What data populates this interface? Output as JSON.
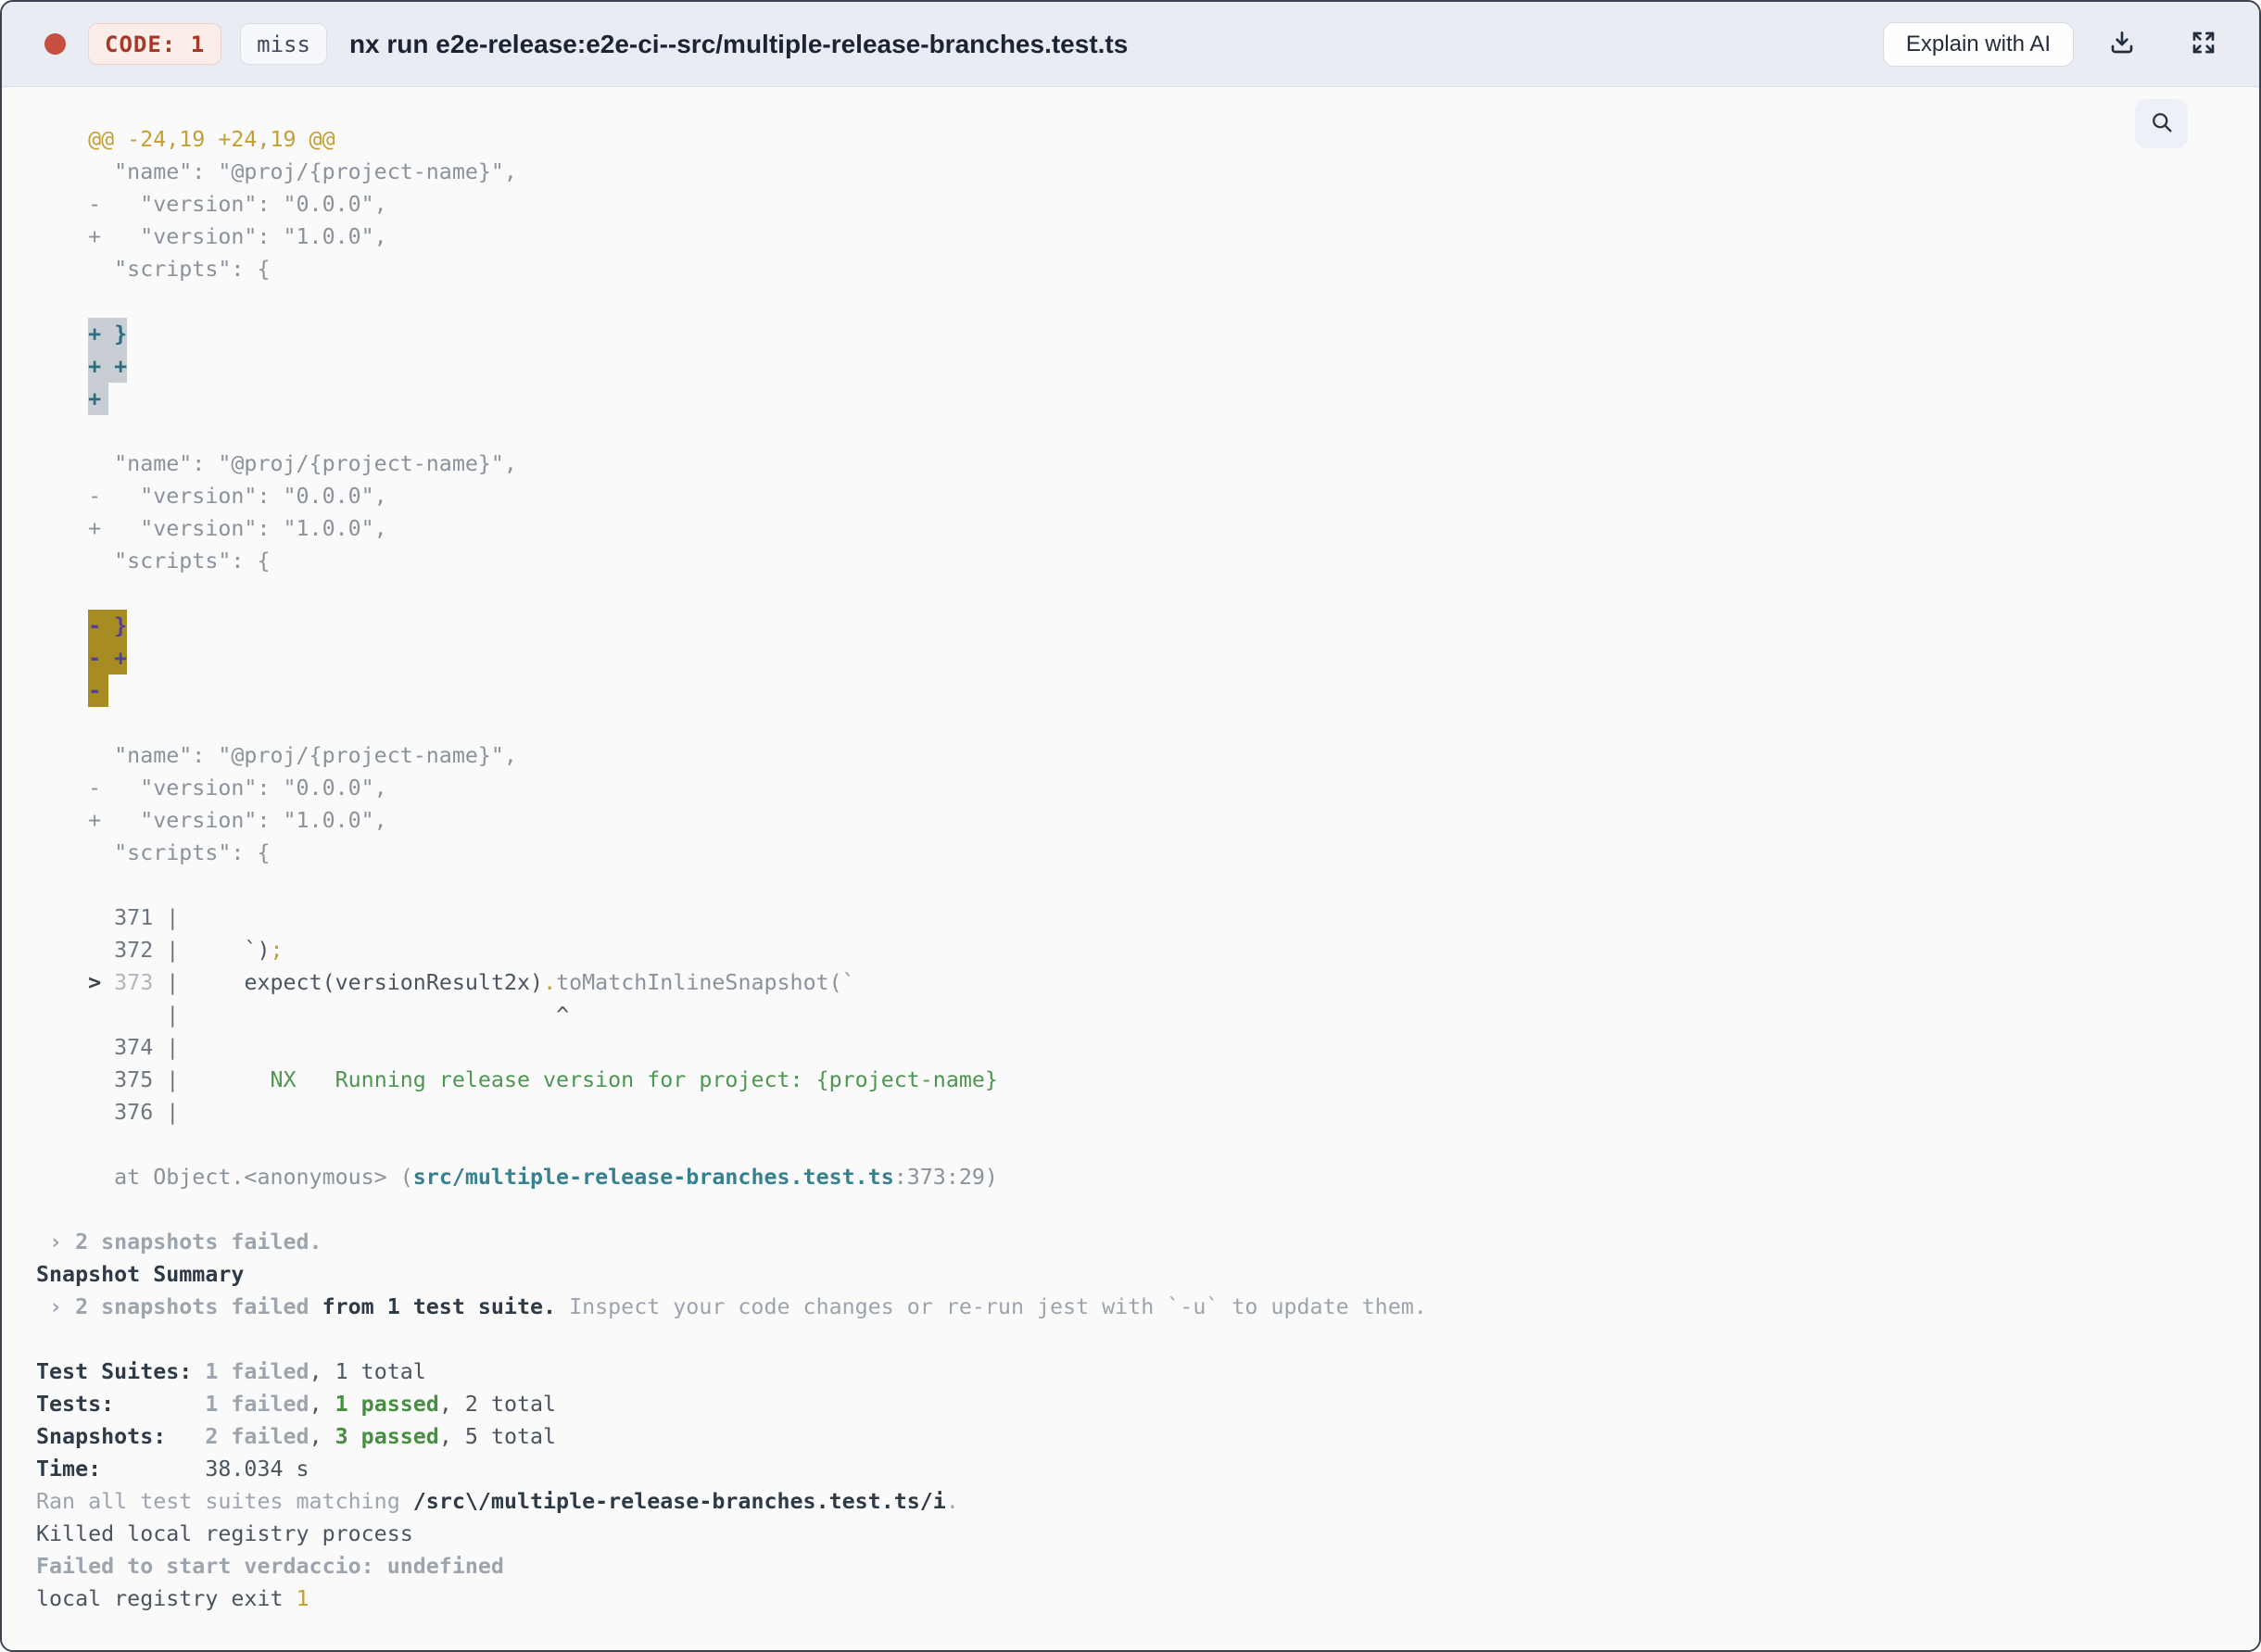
{
  "header": {
    "exit_code_badge": "CODE: 1",
    "cache_badge": "miss",
    "title": "nx run e2e-release:e2e-ci--src/multiple-release-branches.test.ts",
    "explain_button": "Explain with AI",
    "status_dot_color": "#C5503F",
    "icons": {
      "download": "download-tray-arrow",
      "expand": "fullscreen-four-arrows",
      "search": "magnifier"
    }
  },
  "colors": {
    "header_bg": "#E9EDF3",
    "content_bg": "#FAFAFB",
    "diff_hunk_gold": "#C2A033",
    "context_gray": "#8A929C",
    "added_highlight_bg": "#C9CED4",
    "added_highlight_fg": "#2C6E80",
    "removed_highlight_bg": "#A78C22",
    "removed_highlight_fg": "#4E3FA2",
    "pass_green": "#478E41",
    "link_teal": "#35818F",
    "fail_gray": "#9CA4AD",
    "code_badge_red": "#A63A2A"
  },
  "terminal": {
    "lines": [
      {
        "segments": [
          {
            "t": "    @@ -24,19 +24,19 @@",
            "s": "gold"
          }
        ]
      },
      {
        "segments": [
          {
            "t": "      \"name\": \"@proj/{project-name}\",",
            "s": "ctx"
          }
        ]
      },
      {
        "segments": [
          {
            "t": "    -   \"version\": \"0.0.0\",",
            "s": "ctx"
          }
        ]
      },
      {
        "segments": [
          {
            "t": "    +   \"version\": \"1.0.0\",",
            "s": "ctx"
          }
        ]
      },
      {
        "segments": [
          {
            "t": "      \"scripts\": {",
            "s": "ctx"
          }
        ]
      },
      {
        "segments": []
      },
      {
        "segments": [
          {
            "t": "    ",
            "s": "ctx"
          },
          {
            "t": "+ }",
            "s": "add"
          }
        ]
      },
      {
        "segments": [
          {
            "t": "    ",
            "s": "ctx"
          },
          {
            "t": "+ +",
            "s": "add"
          }
        ]
      },
      {
        "segments": [
          {
            "t": "    ",
            "s": "ctx"
          },
          {
            "t": "+",
            "s": "add",
            "pad": true
          }
        ]
      },
      {
        "segments": []
      },
      {
        "segments": [
          {
            "t": "      \"name\": \"@proj/{project-name}\",",
            "s": "ctx"
          }
        ]
      },
      {
        "segments": [
          {
            "t": "    -   \"version\": \"0.0.0\",",
            "s": "ctx"
          }
        ]
      },
      {
        "segments": [
          {
            "t": "    +   \"version\": \"1.0.0\",",
            "s": "ctx"
          }
        ]
      },
      {
        "segments": [
          {
            "t": "      \"scripts\": {",
            "s": "ctx"
          }
        ]
      },
      {
        "segments": []
      },
      {
        "segments": [
          {
            "t": "    ",
            "s": "ctx"
          },
          {
            "t": "- }",
            "s": "del"
          }
        ]
      },
      {
        "segments": [
          {
            "t": "    ",
            "s": "ctx"
          },
          {
            "t": "- +",
            "s": "del"
          }
        ]
      },
      {
        "segments": [
          {
            "t": "    ",
            "s": "ctx"
          },
          {
            "t": "-",
            "s": "del",
            "pad": true
          }
        ]
      },
      {
        "segments": []
      },
      {
        "segments": [
          {
            "t": "      \"name\": \"@proj/{project-name}\",",
            "s": "ctx"
          }
        ]
      },
      {
        "segments": [
          {
            "t": "    -   \"version\": \"0.0.0\",",
            "s": "ctx"
          }
        ]
      },
      {
        "segments": [
          {
            "t": "    +   \"version\": \"1.0.0\",",
            "s": "ctx"
          }
        ]
      },
      {
        "segments": [
          {
            "t": "      \"scripts\": {",
            "s": "ctx"
          }
        ]
      },
      {
        "segments": []
      },
      {
        "segments": [
          {
            "t": "      371 |",
            "s": "ln"
          }
        ]
      },
      {
        "segments": [
          {
            "t": "      372 |",
            "s": "ln"
          },
          {
            "t": "     ",
            "s": "ctx"
          },
          {
            "t": "`)",
            "s": "dark"
          },
          {
            "t": ";",
            "s": "gold"
          }
        ]
      },
      {
        "segments": [
          {
            "t": "    ",
            "s": "ctx"
          },
          {
            "t": ">",
            "s": "arrow"
          },
          {
            "t": " ",
            "s": "ctx"
          },
          {
            "t": "373",
            "s": "lnd"
          },
          {
            "t": " |",
            "s": "ln"
          },
          {
            "t": "     ",
            "s": "ctx"
          },
          {
            "t": "expect(versionResult2x)",
            "s": "dark"
          },
          {
            "t": ".",
            "s": "gold"
          },
          {
            "t": "toMatchInlineSnapshot(`",
            "s": "ctx"
          }
        ]
      },
      {
        "segments": [
          {
            "t": "          |",
            "s": "ln"
          },
          {
            "t": "                             ",
            "s": "ctx"
          },
          {
            "t": "^",
            "s": "caret"
          }
        ]
      },
      {
        "segments": [
          {
            "t": "      374 |",
            "s": "ln"
          }
        ]
      },
      {
        "segments": [
          {
            "t": "      375 |",
            "s": "ln"
          },
          {
            "t": "       ",
            "s": "ctx"
          },
          {
            "t": "NX   Running release version for project: {project-name}",
            "s": "green"
          }
        ]
      },
      {
        "segments": [
          {
            "t": "      376 |",
            "s": "ln"
          }
        ]
      },
      {
        "segments": []
      },
      {
        "segments": [
          {
            "t": "      at Object.<anonymous> (",
            "s": "ctx"
          },
          {
            "t": "src/multiple-release-branches.test.ts",
            "s": "teal"
          },
          {
            "t": ":373:29)",
            "s": "ctx"
          }
        ]
      },
      {
        "segments": []
      },
      {
        "segments": [
          {
            "t": " › 2 snapshots failed.",
            "s": "grayb"
          }
        ]
      },
      {
        "segments": [
          {
            "t": "Snapshot Summary",
            "s": "darkb"
          }
        ]
      },
      {
        "segments": [
          {
            "t": " › 2 snapshots failed",
            "s": "grayb"
          },
          {
            "t": " from 1 test suite.",
            "s": "darkb"
          },
          {
            "t": " Inspect your code changes or re-run jest with `-u` to update them.",
            "s": "gray"
          }
        ]
      },
      {
        "segments": []
      },
      {
        "segments": [
          {
            "t": "Test Suites:",
            "s": "darkb"
          },
          {
            "t": " ",
            "s": "dark"
          },
          {
            "t": "1 failed",
            "s": "grayb"
          },
          {
            "t": ", 1 total",
            "s": "dark"
          }
        ]
      },
      {
        "segments": [
          {
            "t": "Tests:",
            "s": "darkb"
          },
          {
            "t": "       ",
            "s": "dark"
          },
          {
            "t": "1 failed",
            "s": "grayb"
          },
          {
            "t": ", ",
            "s": "dark"
          },
          {
            "t": "1 passed",
            "s": "greenb"
          },
          {
            "t": ", 2 total",
            "s": "dark"
          }
        ]
      },
      {
        "segments": [
          {
            "t": "Snapshots:",
            "s": "darkb"
          },
          {
            "t": "   ",
            "s": "dark"
          },
          {
            "t": "2 failed",
            "s": "grayb"
          },
          {
            "t": ", ",
            "s": "dark"
          },
          {
            "t": "3 passed",
            "s": "greenb"
          },
          {
            "t": ", 5 total",
            "s": "dark"
          }
        ]
      },
      {
        "segments": [
          {
            "t": "Time:",
            "s": "darkb"
          },
          {
            "t": "        ",
            "s": "dark"
          },
          {
            "t": "38.034 s",
            "s": "dark"
          }
        ]
      },
      {
        "segments": [
          {
            "t": "Ran all test suites matching ",
            "s": "gray"
          },
          {
            "t": "/src\\/multiple-release-branches.test.ts/i",
            "s": "darkb"
          },
          {
            "t": ".",
            "s": "gray"
          }
        ]
      },
      {
        "segments": [
          {
            "t": "Killed local registry process",
            "s": "dark"
          }
        ]
      },
      {
        "segments": [
          {
            "t": "Failed to start verdaccio: undefined",
            "s": "grayb"
          }
        ]
      },
      {
        "segments": [
          {
            "t": "local registry exit ",
            "s": "dark"
          },
          {
            "t": "1",
            "s": "gold"
          }
        ]
      }
    ]
  }
}
